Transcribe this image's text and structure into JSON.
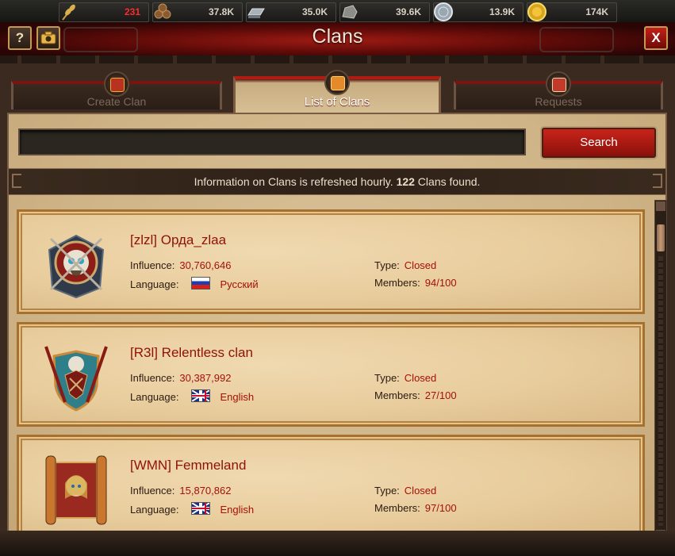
{
  "resources": [
    {
      "icon": "wheat-icon",
      "value": "231",
      "low": true
    },
    {
      "icon": "wood-logs-icon",
      "value": "37.8K",
      "low": false
    },
    {
      "icon": "iron-ingot-icon",
      "value": "35.0K",
      "low": false
    },
    {
      "icon": "stone-icon",
      "value": "39.6K",
      "low": false
    },
    {
      "icon": "silver-coin-icon",
      "value": "13.9K",
      "low": false
    },
    {
      "icon": "gold-coin-icon",
      "value": "174K",
      "low": false
    }
  ],
  "window": {
    "title": "Clans",
    "help_label": "?",
    "close_label": "X"
  },
  "tabs": [
    {
      "label": "Create Clan",
      "active": false
    },
    {
      "label": "List of Clans",
      "active": true
    },
    {
      "label": "Requests",
      "active": false
    }
  ],
  "search": {
    "value": "",
    "placeholder": "",
    "button_label": "Search"
  },
  "info": {
    "prefix": "Information on Clans is refreshed hourly. ",
    "count": "122",
    "suffix": " Clans found."
  },
  "labels": {
    "influence": "Influence:",
    "language": "Language:",
    "type": "Type:",
    "members": "Members:"
  },
  "clans": [
    {
      "name": "[zlzl] Орда_zlaa",
      "influence": "30,760,646",
      "language": "Русский",
      "flag": "ru",
      "type": "Closed",
      "members": "94/100",
      "emblem": "skull-shield-emblem-icon"
    },
    {
      "name": "[R3l] Relentless clan",
      "influence": "30,387,992",
      "language": "English",
      "flag": "gb",
      "type": "Closed",
      "members": "27/100",
      "emblem": "eagle-shield-emblem-icon"
    },
    {
      "name": "[WMN] Femmeland",
      "influence": "15,870,862",
      "language": "English",
      "flag": "gb",
      "type": "Closed",
      "members": "97/100",
      "emblem": "scroll-portrait-emblem-icon"
    }
  ],
  "colors": {
    "accent_red": "#a3110a",
    "parchment": "#e8cc9c",
    "frame_gold": "#a6712f"
  }
}
